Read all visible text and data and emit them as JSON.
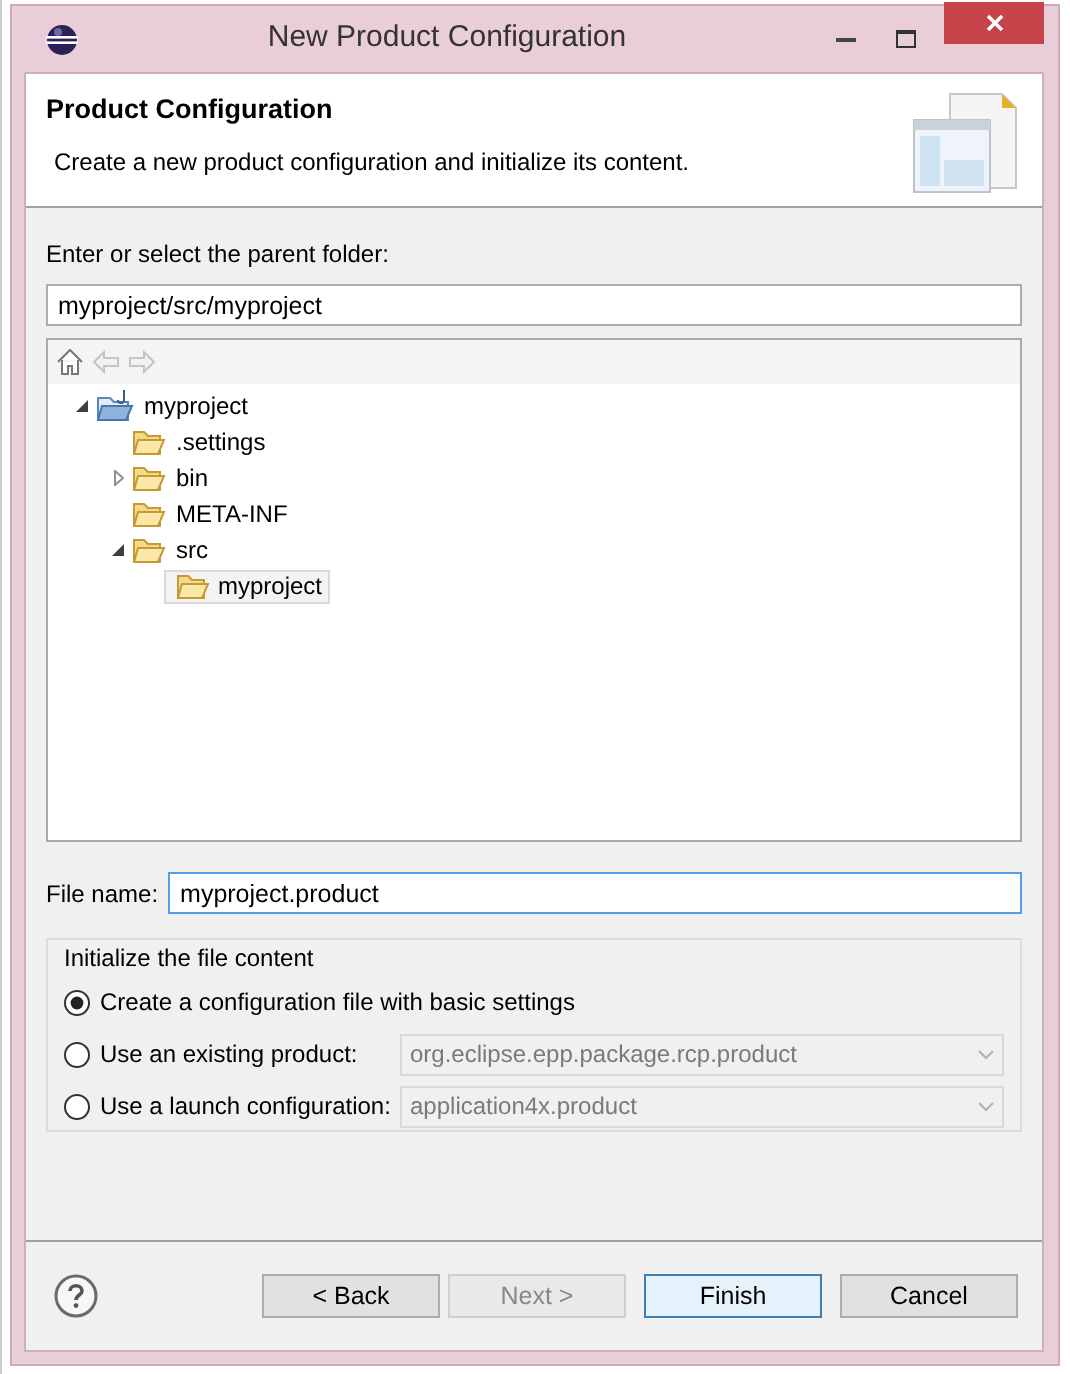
{
  "window": {
    "title": "New Product Configuration"
  },
  "header": {
    "title": "Product Configuration",
    "description": "Create a new product configuration and initialize its content."
  },
  "parent_folder": {
    "label": "Enter or select the parent folder:",
    "value": "myproject/src/myproject"
  },
  "tree": {
    "items": [
      {
        "label": "myproject",
        "kind": "project",
        "expanded": true,
        "selected": false,
        "children": [
          {
            "label": ".settings",
            "kind": "folder",
            "selected": false
          },
          {
            "label": "bin",
            "kind": "folder",
            "expanded": false,
            "selected": false
          },
          {
            "label": "META-INF",
            "kind": "folder",
            "selected": false
          },
          {
            "label": "src",
            "kind": "folder",
            "expanded": true,
            "selected": false,
            "children": [
              {
                "label": "myproject",
                "kind": "folder",
                "selected": true
              }
            ]
          }
        ]
      }
    ]
  },
  "file_name": {
    "label": "File name:",
    "value": "myproject.product"
  },
  "init_group": {
    "legend": "Initialize the file content",
    "options": [
      {
        "label": "Create a configuration file with basic settings",
        "kind": "plain",
        "selected": true
      },
      {
        "label": "Use an existing product:",
        "kind": "combo",
        "selected": false,
        "combo": {
          "value": "org.eclipse.epp.package.rcp.product",
          "disabled": true
        }
      },
      {
        "label": "Use a launch configuration:",
        "kind": "combo",
        "selected": false,
        "combo": {
          "value": "application4x.product",
          "disabled": true
        }
      }
    ]
  },
  "buttons": [
    {
      "label": "< Back",
      "disabled": false,
      "default": false
    },
    {
      "label": "Next >",
      "disabled": true,
      "default": false
    },
    {
      "label": "Finish",
      "disabled": false,
      "default": true
    },
    {
      "label": "Cancel",
      "disabled": false,
      "default": false
    }
  ]
}
